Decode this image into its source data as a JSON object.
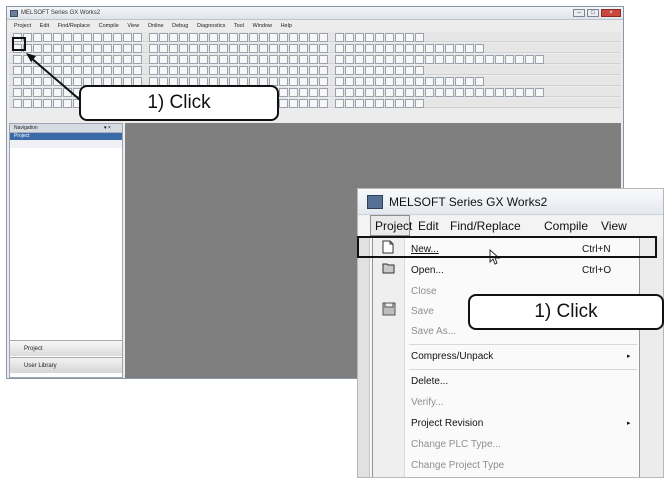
{
  "back_window": {
    "title": "MELSOFT Series GX Works2",
    "menu": [
      "Project",
      "Edit",
      "Find/Replace",
      "Compile",
      "View",
      "Online",
      "Debug",
      "Diagnostics",
      "Tool",
      "Window",
      "Help"
    ],
    "nav_header": "Navigation",
    "nav_pin": "▾ ×",
    "nav_sub": "Project",
    "nav_bottom_project": "Project",
    "nav_bottom_userlib": "User Library",
    "window_buttons": [
      "–",
      "□",
      "×"
    ]
  },
  "callouts": {
    "first": "1) Click",
    "second": "1) Click"
  },
  "front_window": {
    "title": "MELSOFT Series GX Works2",
    "menu": {
      "project": "Project",
      "edit": "Edit",
      "find": "Find/Replace",
      "compile": "Compile",
      "view": "View"
    },
    "items": {
      "new": {
        "label": "New...",
        "shortcut": "Ctrl+N"
      },
      "open": {
        "label": "Open...",
        "shortcut": "Ctrl+O"
      },
      "close": {
        "label": "Close"
      },
      "save": {
        "label": "Save"
      },
      "save_as": {
        "label": "Save As..."
      },
      "compress": {
        "label": "Compress/Unpack",
        "arrow": "▸"
      },
      "delete": {
        "label": "Delete..."
      },
      "verify": {
        "label": "Verify..."
      },
      "revision": {
        "label": "Project Revision",
        "arrow": "▸"
      },
      "change_plc": {
        "label": "Change PLC Type..."
      },
      "change_project": {
        "label": "Change Project Type"
      }
    }
  },
  "icons": {
    "new": "🗋",
    "open": "📂",
    "save": "💾"
  }
}
